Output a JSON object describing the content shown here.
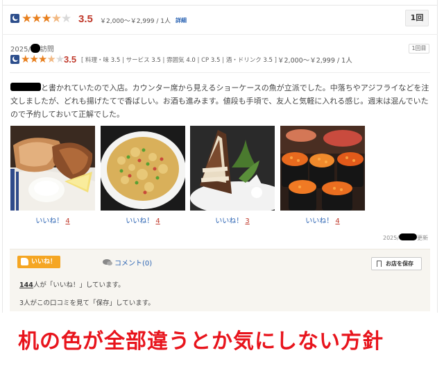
{
  "top": {
    "score": "3.5",
    "rating_fraction": 0.7,
    "price": "￥2,000～￥2,999",
    "people": "/ 1人",
    "detail_link": "詳細",
    "visit_button": "1回"
  },
  "visit": {
    "year": "2025/",
    "suffix": "訪問",
    "count_tag": "1回目",
    "score": "3.5",
    "sub_scores": [
      {
        "label": "料理・味",
        "value": "3.5"
      },
      {
        "label": "サービス",
        "value": "3.5"
      },
      {
        "label": "雰囲気",
        "value": "4.0"
      },
      {
        "label": "CP",
        "value": "3.5"
      },
      {
        "label": "酒・ドリンク",
        "value": "3.5"
      }
    ],
    "price": "￥2,000～￥2,999",
    "people": "/ 1人"
  },
  "review": {
    "text": "と書かれていたので入店。カウンター席から見えるショーケースの魚が立派でした。中落ちやアジフライなどを注文しましたが、どれも揚げたてで香ばしい。お酒も進みます。値段も手頃で、友人と気軽に入れる感じ。週末は混んでいたので予約しておいて正解でした。"
  },
  "photos": [
    {
      "name": "grilled-fish",
      "like_label": "いいね！",
      "like_count": "4"
    },
    {
      "name": "fried-rice",
      "like_label": "いいね！",
      "like_count": "4"
    },
    {
      "name": "cake",
      "like_label": "いいね！",
      "like_count": "3"
    },
    {
      "name": "sushi",
      "like_label": "いいね！",
      "like_count": "4"
    }
  ],
  "updated": {
    "year": "2025/",
    "suffix": "更新"
  },
  "actions": {
    "like_button": "いいね！",
    "comment": "コメント(0)",
    "save_button": "お店を保存",
    "like_count_num": "144",
    "like_count_text": "人が「いいね！」しています。",
    "save_count_text": "3人がこの口コミを見て「保存」しています。"
  },
  "caption": "机の色が全部違うとか気にしない方針",
  "colors": {
    "star": "#e8801f",
    "score": "#c0392b",
    "link": "#2a63b3",
    "like_button": "#f5a623",
    "caption": "#e8141c"
  }
}
